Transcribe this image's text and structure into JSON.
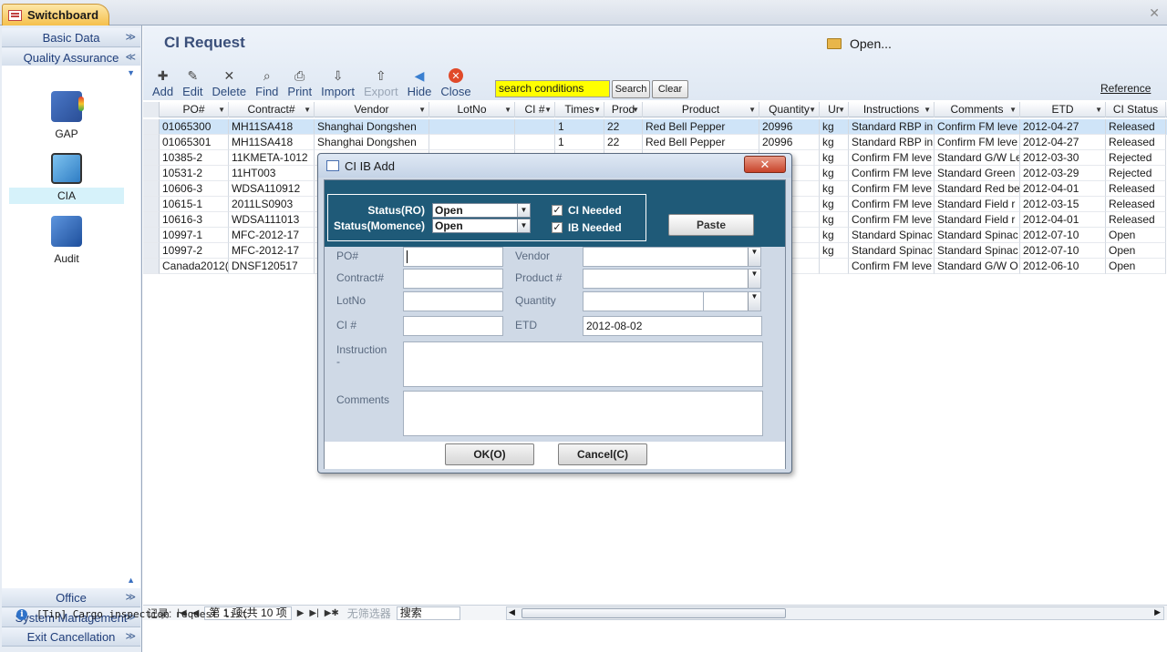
{
  "tab": {
    "title": "Switchboard",
    "close": "✕"
  },
  "sidebar": {
    "groups_top": [
      {
        "label": "Basic Data",
        "chevron": "≫"
      },
      {
        "label": "Quality Assurance",
        "chevron": "≪"
      }
    ],
    "items": [
      {
        "label": "GAP",
        "icon": "gap-icon"
      },
      {
        "label": "CIA",
        "icon": "cia-icon",
        "selected": true
      },
      {
        "label": "Audit",
        "icon": "audit-icon"
      }
    ],
    "groups_bottom": [
      {
        "label": "Office",
        "chevron": "≫"
      },
      {
        "label": "System Management",
        "chevron": "≫"
      },
      {
        "label": "Exit Cancellation",
        "chevron": "≫"
      }
    ]
  },
  "header": {
    "title": "CI Request",
    "open_label": "Open...",
    "reference_label": "Reference"
  },
  "toolbar": {
    "buttons": [
      {
        "label": "Add",
        "icon": "add-icon",
        "glyph": "✚",
        "enabled": true
      },
      {
        "label": "Edit",
        "icon": "edit-icon",
        "glyph": "✎",
        "enabled": true
      },
      {
        "label": "Delete",
        "icon": "delete-icon",
        "glyph": "✕",
        "enabled": true
      },
      {
        "label": "Find",
        "icon": "find-icon",
        "glyph": "⌕",
        "enabled": true
      },
      {
        "label": "Print",
        "icon": "print-icon",
        "glyph": "⎙",
        "enabled": true
      },
      {
        "label": "Import",
        "icon": "import-icon",
        "glyph": "⇩",
        "enabled": true
      },
      {
        "label": "Export",
        "icon": "export-icon",
        "glyph": "⇧",
        "enabled": false
      },
      {
        "label": "Hide",
        "icon": "hide-icon",
        "glyph": "◀",
        "enabled": true
      },
      {
        "label": "Close",
        "icon": "close-icon",
        "glyph": "✕",
        "enabled": true
      }
    ],
    "search_value": "search conditions",
    "search_button": "Search",
    "clear_button": "Clear"
  },
  "grid": {
    "columns": [
      "PO#",
      "Contract#",
      "Vendor",
      "LotNo",
      "CI #",
      "Times",
      "Prod",
      "Product",
      "Quantity",
      "Ur",
      "Instructions",
      "Comments",
      "ETD",
      "CI Status"
    ],
    "rows": [
      [
        "01065300",
        "MH11SA418",
        "Shanghai Dongshen",
        "",
        "",
        "1",
        "22",
        "Red Bell Pepper",
        "20996",
        "kg",
        "Standard RBP in",
        "Confirm FM leve",
        "2012-04-27",
        "Released"
      ],
      [
        "01065301",
        "MH11SA418",
        "Shanghai Dongshen",
        "",
        "",
        "1",
        "22",
        "Red Bell Pepper",
        "20996",
        "kg",
        "Standard RBP in",
        "Confirm FM leve",
        "2012-04-27",
        "Released"
      ],
      [
        "10385-2",
        "11KMETA-1012",
        "",
        "",
        "",
        "",
        "",
        "",
        "",
        "kg",
        "Confirm FM leve",
        "Standard G/W Le",
        "2012-03-30",
        "Rejected"
      ],
      [
        "10531-2",
        "11HT003",
        "",
        "",
        "",
        "",
        "",
        "",
        "",
        "kg",
        "Confirm FM leve",
        "Standard Green",
        "2012-03-29",
        "Rejected"
      ],
      [
        "10606-3",
        "WDSA110912",
        "",
        "",
        "",
        "",
        "",
        "",
        "",
        "kg",
        "Confirm FM leve",
        "Standard Red be",
        "2012-04-01",
        "Released"
      ],
      [
        "10615-1",
        "2011LS0903",
        "",
        "",
        "",
        "",
        "",
        "",
        "",
        "kg",
        "Confirm FM leve",
        "Standard Field r",
        "2012-03-15",
        "Released"
      ],
      [
        "10616-3",
        "WDSA111013",
        "",
        "",
        "",
        "",
        "",
        "",
        "",
        "kg",
        "Confirm FM leve",
        "Standard Field r",
        "2012-04-01",
        "Released"
      ],
      [
        "10997-1",
        "MFC-2012-17",
        "",
        "",
        "",
        "",
        "",
        "",
        "",
        "kg",
        "Standard Spinac",
        "Standard Spinac",
        "2012-07-10",
        "Open"
      ],
      [
        "10997-2",
        "MFC-2012-17",
        "",
        "",
        "",
        "",
        "",
        "",
        "",
        "kg",
        "Standard Spinac",
        "Standard Spinac",
        "2012-07-10",
        "Open"
      ],
      [
        "Canada2012(",
        "DNSF120517",
        "",
        "",
        "",
        "",
        "",
        "",
        "",
        "",
        "Confirm FM leve",
        "Standard G/W O",
        "2012-06-10",
        "Open"
      ]
    ]
  },
  "navbar": {
    "record_label": "记录:",
    "record_value": "第 1 项(共 10 项",
    "filter_label": "无筛选器",
    "search_value": "搜索"
  },
  "tip": "[Tip] Cargo inspection request list",
  "dialog": {
    "title": "CI IB Add",
    "close": "✕",
    "status_ro_label": "Status(RO)",
    "status_ro_value": "Open",
    "status_momence_label": "Status(Momence)",
    "status_momence_value": "Open",
    "ci_needed_label": "CI Needed",
    "ib_needed_label": "IB Needed",
    "paste_label": "Paste",
    "fields": {
      "po_label": "PO#",
      "vendor_label": "Vendor",
      "contract_label": "Contract#",
      "product_label": "Product #",
      "lotno_label": "LotNo",
      "quantity_label": "Quantity",
      "ci_label": "CI #",
      "etd_label": "ETD",
      "etd_value": "2012-08-02",
      "instruction_label": "Instruction",
      "instruction_mark": "-",
      "comments_label": "Comments"
    },
    "ok_label": "OK(O)",
    "cancel_label": "Cancel(C)"
  }
}
